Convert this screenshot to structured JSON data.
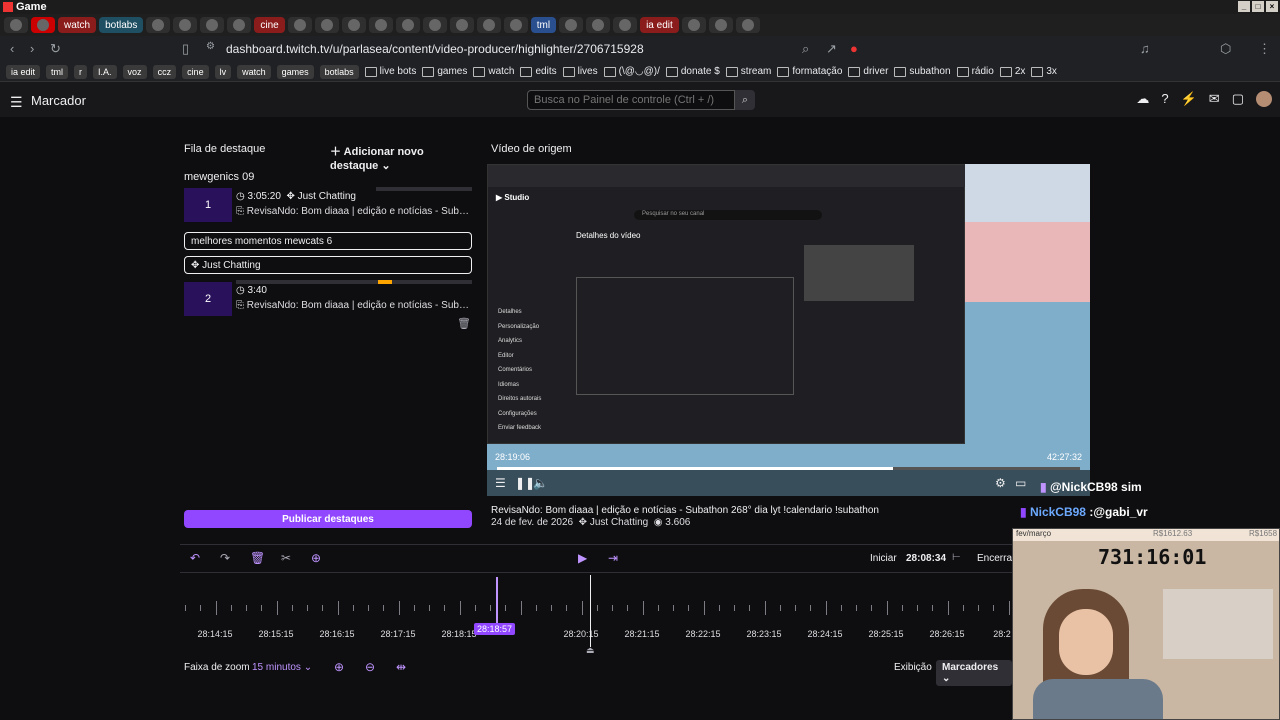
{
  "os": {
    "window_title": "Game"
  },
  "tabs": [
    {
      "label": "",
      "color": "#2f2f2f"
    },
    {
      "label": "",
      "color": "#cc0000"
    },
    {
      "label": "watch",
      "color": "#8b1c1c"
    },
    {
      "label": "botlabs",
      "color": "#1f4f63"
    },
    {
      "label": "",
      "color": "#2f2f2f"
    },
    {
      "label": "",
      "color": "#2f2f2f"
    },
    {
      "label": "",
      "color": "#2f2f2f"
    },
    {
      "label": "",
      "color": "#2f2f2f"
    },
    {
      "label": "cine",
      "color": "#8b1c1c"
    },
    {
      "label": "",
      "color": "#2f2f2f"
    },
    {
      "label": "",
      "color": "#2f2f2f"
    },
    {
      "label": "",
      "color": "#2f2f2f"
    },
    {
      "label": "",
      "color": "#2f2f2f"
    },
    {
      "label": "",
      "color": "#2f2f2f"
    },
    {
      "label": "",
      "color": "#2f2f2f"
    },
    {
      "label": "",
      "color": "#2f2f2f"
    },
    {
      "label": "",
      "color": "#2f2f2f"
    },
    {
      "label": "",
      "color": "#2f2f2f"
    },
    {
      "label": "tml",
      "color": "#2a4f8f"
    },
    {
      "label": "",
      "color": "#2f2f2f"
    },
    {
      "label": "",
      "color": "#2f2f2f"
    },
    {
      "label": "",
      "color": "#2f2f2f"
    },
    {
      "label": "ia edit",
      "color": "#8b1c1c"
    },
    {
      "label": "",
      "color": "#2f2f2f"
    },
    {
      "label": "",
      "color": "#2f2f2f"
    },
    {
      "label": "",
      "color": "#2f2f2f"
    }
  ],
  "address": {
    "url": "dashboard.twitch.tv/u/parlasea/content/video-producer/highlighter/2706715928"
  },
  "bookmarks": {
    "chips": [
      "ia edit",
      "tml",
      "r",
      "I.A.",
      "voz",
      "ccz",
      "cine",
      "lv",
      "watch",
      "games",
      "botlabs"
    ],
    "folders": [
      "live bots",
      "games",
      "watch",
      "edits",
      "lives",
      "(\\@◡@)/",
      "donate $",
      "stream",
      "formatação",
      "driver",
      "subathon",
      "rádio",
      "2x",
      "3x"
    ]
  },
  "topnav": {
    "page_title": "Marcador",
    "search_placeholder": "Busca no Painel de controle (Ctrl + /)"
  },
  "queue": {
    "header": "Fila de destaque",
    "add_button": "Adicionar novo destaque",
    "groups": [
      {
        "name": "mewgenics 09",
        "clips": [
          {
            "num": "1",
            "duration": "3:05:20",
            "category": "Just Chatting",
            "title": "RevisaNdo: Bom diaaa | edição e notícias - Subathon 268° dia lyt !calendario !subathon"
          }
        ]
      },
      {
        "name_value": "melhores momentos mewcats 6",
        "category_value": "Just Chatting",
        "clips": [
          {
            "num": "2",
            "duration": "3:40",
            "title": "RevisaNdo: Bom diaaa | edição e notícias - Subathon 268° dia lyt !calendario !subathon"
          }
        ]
      }
    ],
    "publish": "Publicar destaques"
  },
  "video": {
    "label": "Vídeo de origem",
    "time_left": "28:19:06",
    "time_right": "42:27:32",
    "progress": 0.68,
    "meta_title": "RevisaNdo: Bom diaaa | edição e notícias - Subathon 268° dia lyt !calendario !subathon",
    "meta_date": "24 de fev. de 2026",
    "meta_category": "Just Chatting",
    "meta_views": "3.606",
    "inner": {
      "studio": "Studio",
      "search_placeholder": "Pesquisar no seu canal",
      "page": "Detalhes do vídeo",
      "sidebar": [
        "Detalhes",
        "Personalização",
        "Analytics",
        "Editor",
        "Comentários",
        "Idiomas",
        "Direitos autorais",
        "Configurações",
        "Enviar feedback"
      ]
    }
  },
  "timeline": {
    "start_label": "Iniciar",
    "start_time": "28:08:34",
    "end_label": "Encerrar",
    "playhead_time": "28:18:57",
    "ticks": [
      "28:14:15",
      "28:15:15",
      "28:16:15",
      "28:17:15",
      "28:18:15",
      "28:20:15",
      "28:21:15",
      "28:22:15",
      "28:23:15",
      "28:24:15",
      "28:25:15",
      "28:26:15",
      "28:2"
    ],
    "zoom_label": "Faixa de zoom",
    "zoom_value": "15 minutos",
    "view_label": "Exibição",
    "view_value": "Marcadores"
  },
  "overlay": {
    "chat1": "@NickCB98 sim",
    "chat2_user": "NickCB98",
    "chat2_msg": ":@gabi_vr",
    "webcam_bar": "fev/março",
    "webcam_clock": "731:16:01",
    "money1": "R$1612.63",
    "money2": "R$1658"
  }
}
